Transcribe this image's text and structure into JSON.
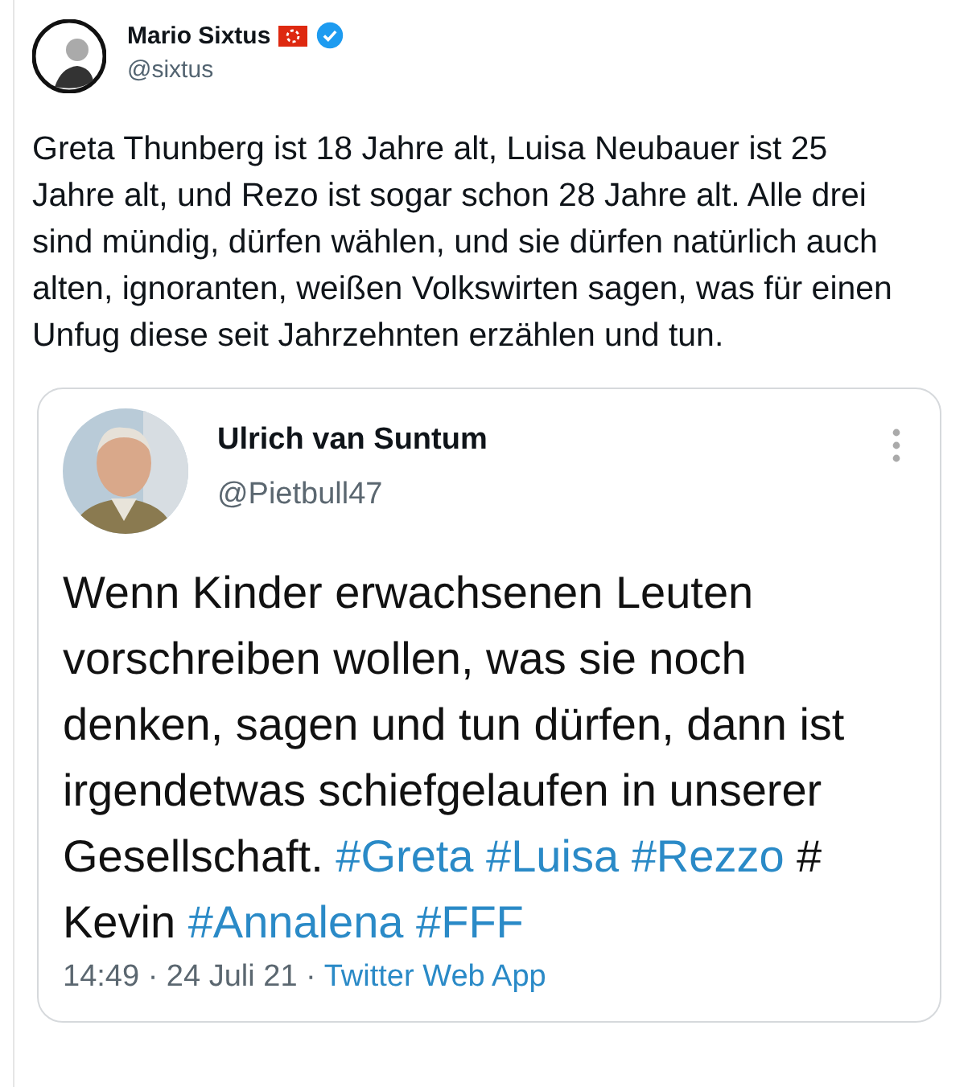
{
  "author": {
    "name": "Mario Sixtus",
    "handle": "@sixtus",
    "verified": true
  },
  "text": "Greta Thunberg ist 18 Jahre alt, Luisa Neubauer ist 25 Jahre alt, und Rezo ist sogar schon 28 Jahre alt. Alle drei sind mündig, dürfen wählen, und sie dürfen natürlich auch alten, ignoranten, weißen Volkswirten sagen, was für einen Unfug diese seit Jahrzehnten erzählen und tun.",
  "quote": {
    "name": "Ulrich van Suntum",
    "handle": "@Pietbull47",
    "segments": [
      {
        "kind": "text",
        "text": "Wenn Kinder erwachsenen Leuten vorschreiben wollen, was sie noch denken, sagen und tun dürfen, dann ist irgendetwas schiefgelaufen in unserer Gesellschaft."
      },
      {
        "kind": "hashtag",
        "text": "#Greta"
      },
      {
        "kind": "hashtag",
        "text": "#Luisa"
      },
      {
        "kind": "hashtag",
        "text": "#Rezzo"
      },
      {
        "kind": "text",
        "text": "# Kevin"
      },
      {
        "kind": "hashtag",
        "text": "#Annalena"
      },
      {
        "kind": "hashtag",
        "text": "#FFF"
      }
    ],
    "time": "14:49 · 24 Juli 21 ·",
    "source": "Twitter Web App"
  }
}
